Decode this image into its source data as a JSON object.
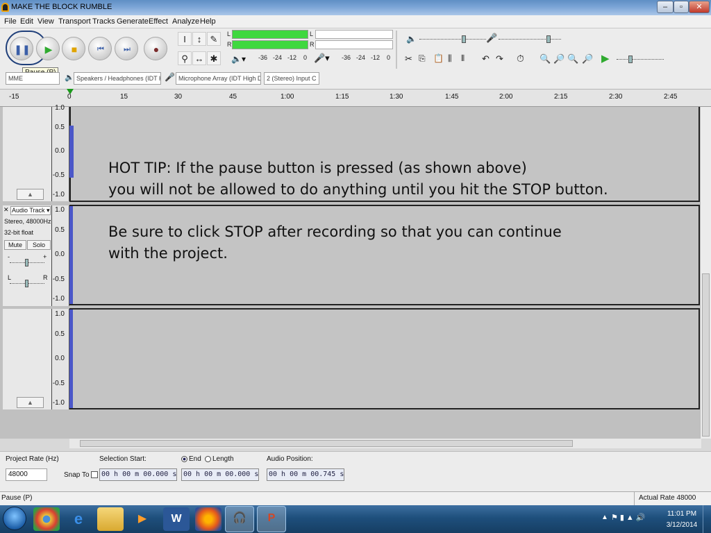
{
  "window": {
    "title": "MAKE THE BLOCK RUMBLE",
    "min": "–",
    "max": "▫",
    "close": "✕"
  },
  "menu": [
    "File",
    "Edit",
    "View",
    "Transport",
    "Tracks",
    "Generate",
    "Effect",
    "Analyze",
    "Help"
  ],
  "transport": {
    "tooltip": "Pause (P)"
  },
  "meters": {
    "left": "L",
    "right": "R",
    "scale": [
      "-36",
      "-24",
      "-12",
      "0"
    ],
    "scale2": [
      "-36",
      "-24",
      "-12",
      "0"
    ]
  },
  "device": {
    "host": "MME",
    "output": "Speakers / Headphones (IDT H",
    "input": "Microphone Array (IDT High De",
    "channels": "2 (Stereo) Input C"
  },
  "ruler": [
    "-15",
    "0",
    "15",
    "30",
    "45",
    "1:00",
    "1:15",
    "1:30",
    "1:45",
    "2:00",
    "2:15",
    "2:30",
    "2:45"
  ],
  "track1": {
    "scale": [
      "1.0",
      "0.5",
      "0.0",
      "-0.5",
      "-1.0"
    ]
  },
  "track2": {
    "name": "Audio Track",
    "info1": "Stereo, 48000Hz",
    "info2": "32-bit float",
    "mute": "Mute",
    "solo": "Solo",
    "gain_minus": "-",
    "gain_plus": "+",
    "pan_l": "L",
    "pan_r": "R",
    "close": "✕",
    "scale": [
      "1.0",
      "0.5",
      "0.0",
      "-0.5",
      "-1.0"
    ]
  },
  "track3": {
    "scale": [
      "1.0",
      "0.5",
      "0.0",
      "-0.5",
      "-1.0"
    ]
  },
  "notes": {
    "tip_line1": "HOT TIP: If the pause button is pressed (as shown above)",
    "tip_line2": "you will not be allowed to do anything until you hit the STOP button.",
    "tip_line3": "Be sure to click STOP after recording so that you can continue",
    "tip_line4": "with the project."
  },
  "selection": {
    "rate_label": "Project Rate (Hz)",
    "rate_value": "48000",
    "snap_label": "Snap To",
    "start_label": "Selection Start:",
    "end_label": "End",
    "length_label": "Length",
    "start_value": "00 h 00 m 00.000 s",
    "end_value": "00 h 00 m 00.000 s",
    "pos_label": "Audio Position:",
    "pos_value": "00 h 00 m 00.745 s"
  },
  "status": {
    "left": "Pause (P)",
    "right": "Actual Rate 48000"
  },
  "taskbar": {
    "time": "11:01 PM",
    "date": "3/12/2014"
  }
}
